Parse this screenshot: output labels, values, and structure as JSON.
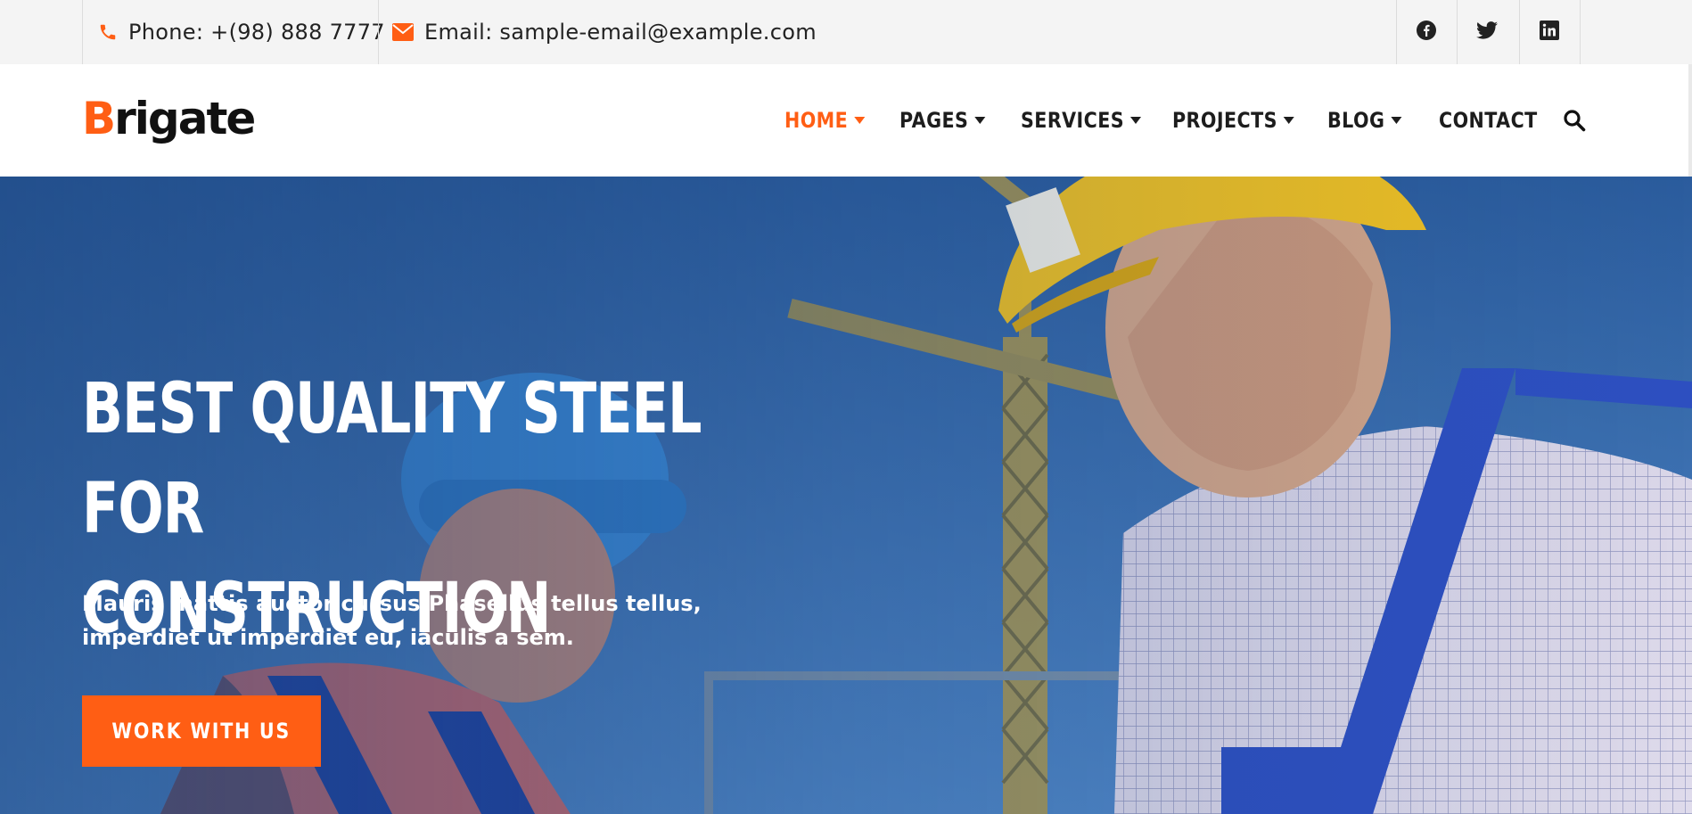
{
  "topbar": {
    "phone_label": "Phone: +(98) 888 7777",
    "email_label": "Email: sample-email@example.com",
    "icons": [
      "phone-icon",
      "envelope-icon",
      "facebook-icon",
      "twitter-icon",
      "linkedin-icon"
    ]
  },
  "header": {
    "logo_first": "B",
    "logo_rest": "rigate",
    "nav": [
      {
        "label": "HOME",
        "dropdown": true,
        "active": true
      },
      {
        "label": "PAGES",
        "dropdown": true
      },
      {
        "label": "SERVICES",
        "dropdown": true
      },
      {
        "label": "PROJECTS",
        "dropdown": true
      },
      {
        "label": "BLOG",
        "dropdown": true
      },
      {
        "label": "CONTACT",
        "dropdown": false
      }
    ],
    "search_icon": "search-icon"
  },
  "hero": {
    "title_line1": "BEST QUALITY STEEL FOR",
    "title_line2": "CONSTRUCTION",
    "subtitle": "Mauris mattis auctor cursus.Phasellus tellus tellus, imperdiet ut imperdiet eu, iaculis a sem.",
    "cta_label": "WORK WITH US"
  },
  "colors": {
    "accent": "#ff5e14",
    "topbar_bg": "#f4f4f4",
    "text_dark": "#1d1d1d",
    "hero_sky": "#3f78b8"
  }
}
